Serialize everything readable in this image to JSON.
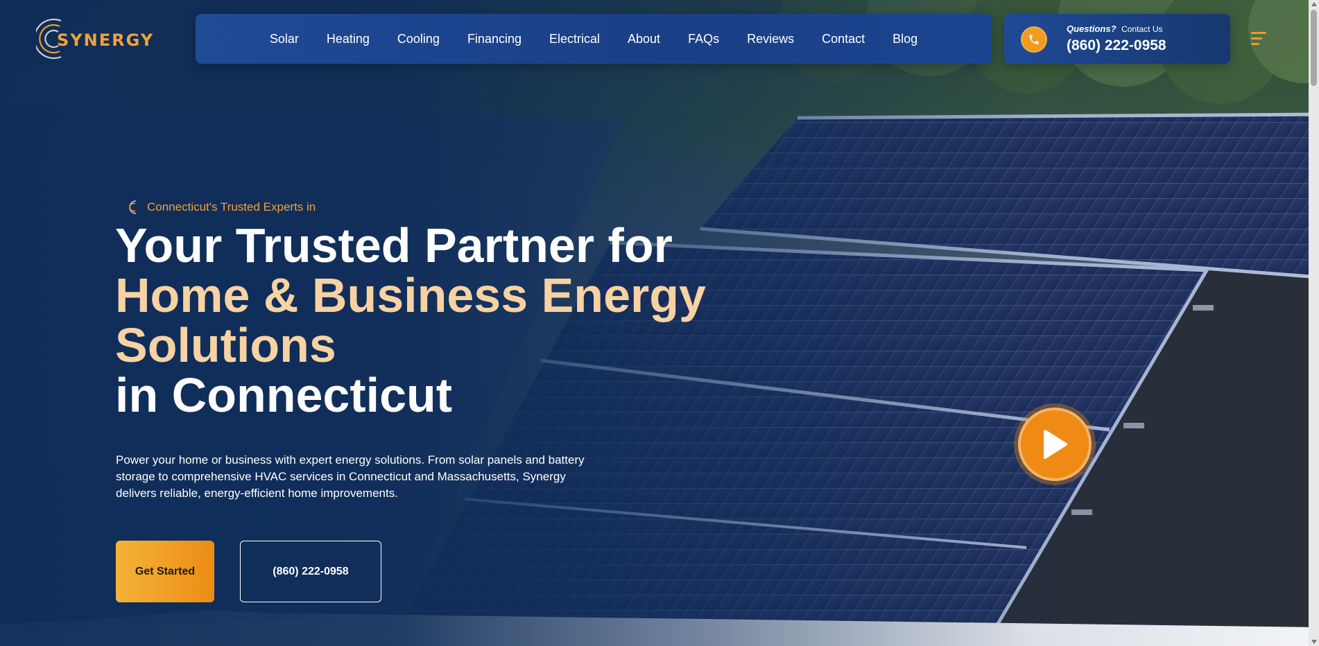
{
  "brand": {
    "name": "SYNERGY",
    "accent_color": "#f39a1f",
    "primary_color": "#1f4a96"
  },
  "nav": {
    "items": [
      "Solar",
      "Heating",
      "Cooling",
      "Financing",
      "Electrical",
      "About",
      "FAQs",
      "Reviews",
      "Contact",
      "Blog"
    ]
  },
  "contact": {
    "question": "Questions?",
    "contact_us": "Contact Us",
    "phone": "(860) 222-0958",
    "icon": "phone-icon"
  },
  "menu": {
    "icon": "hamburger-menu-icon"
  },
  "hero": {
    "eyebrow": "Connecticut's Trusted Experts in",
    "title_line1": "Your Trusted Partner for",
    "title_accent_line1": "Home & Business Energy",
    "title_accent_line2": "Solutions",
    "title_line4": "in Connecticut",
    "description": "Power your home or business with expert energy solutions. From solar panels and battery storage to comprehensive HVAC services in Connecticut and Massachusetts, Synergy delivers reliable, energy-efficient home improvements.",
    "cta_primary": "Get Started",
    "cta_phone": "(860) 222-0958",
    "video_icon": "play-icon"
  }
}
